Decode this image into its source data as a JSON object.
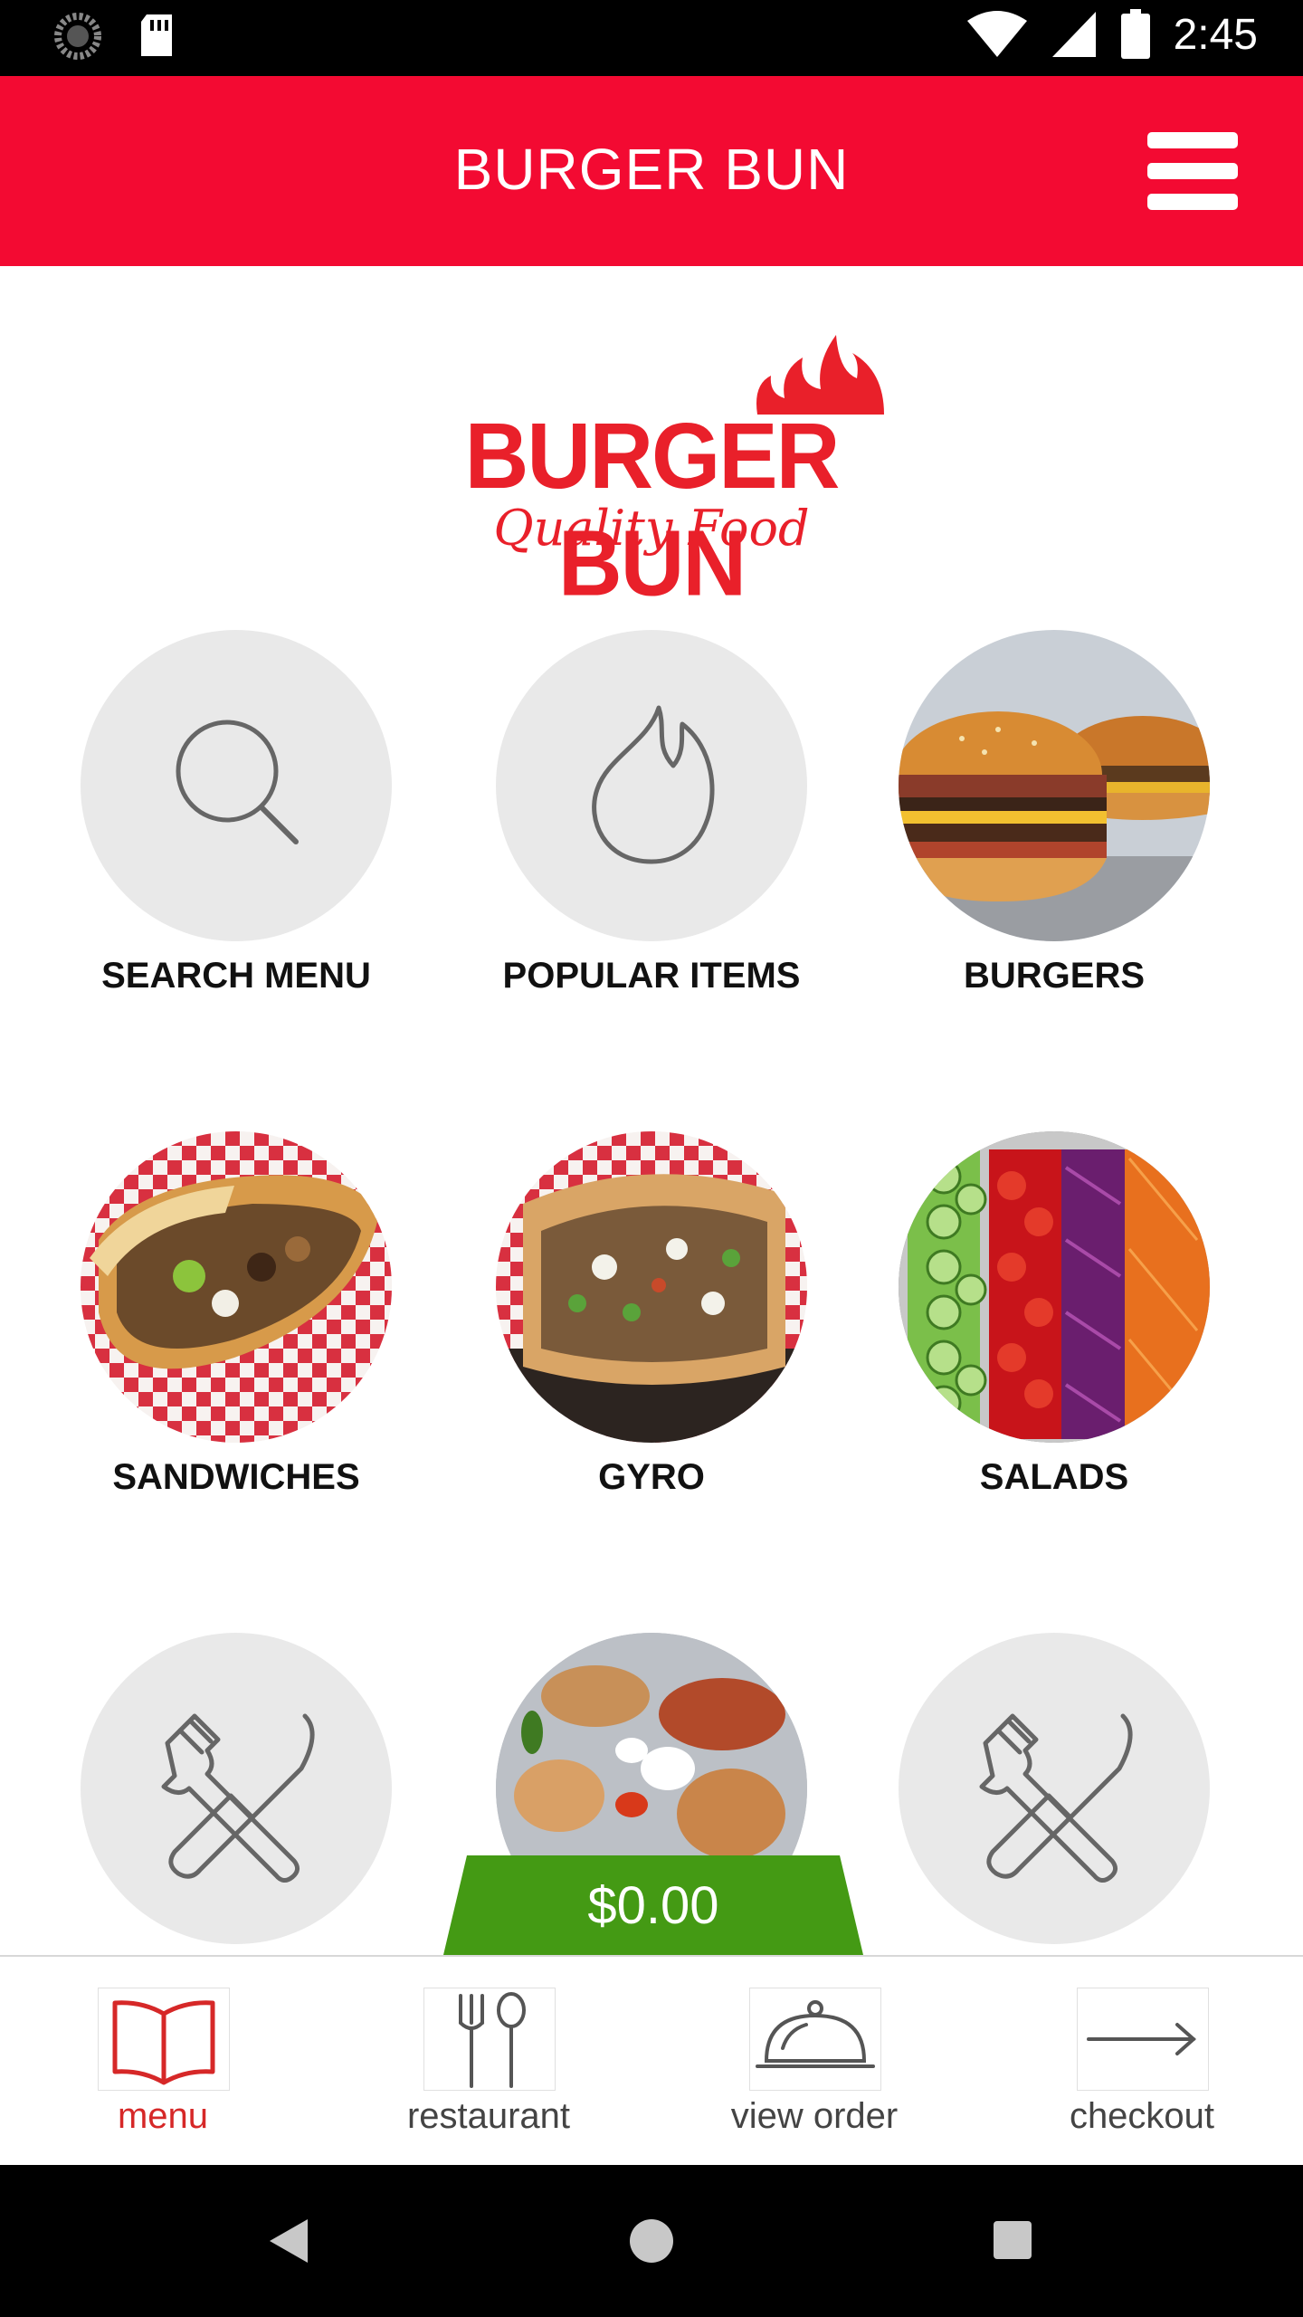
{
  "status_bar": {
    "time": "2:45",
    "icons": [
      "loading-icon",
      "sd-card-icon",
      "wifi-icon",
      "signal-icon",
      "battery-icon"
    ]
  },
  "header": {
    "title": "BURGER BUN",
    "menu_icon": "hamburger-menu-icon",
    "background_color": "#f30a32"
  },
  "logo": {
    "text": "BURGER BUN",
    "tagline": "Quality Food",
    "color": "#e9202a"
  },
  "categories": [
    {
      "label": "SEARCH MENU",
      "icon": "search-icon"
    },
    {
      "label": "POPULAR ITEMS",
      "icon": "flame-icon"
    },
    {
      "label": "BURGERS",
      "image": "burgers-photo"
    },
    {
      "label": "SANDWICHES",
      "image": "sandwich-photo"
    },
    {
      "label": "GYRO",
      "image": "gyro-photo"
    },
    {
      "label": "SALADS",
      "image": "salad-photo"
    },
    {
      "label": "",
      "icon": "utensils-icon"
    },
    {
      "label": "",
      "image": "platter-photo"
    },
    {
      "label": "",
      "icon": "utensils-icon"
    }
  ],
  "order": {
    "total": "$0.00",
    "color": "#449a14"
  },
  "bottom_nav": [
    {
      "label": "menu",
      "icon": "book-icon",
      "active": true
    },
    {
      "label": "restaurant",
      "icon": "fork-spoon-icon",
      "active": false
    },
    {
      "label": "view order",
      "icon": "cloche-icon",
      "active": false
    },
    {
      "label": "checkout",
      "icon": "arrow-right-icon",
      "active": false
    }
  ],
  "system_nav": [
    "back-icon",
    "home-icon",
    "recents-icon"
  ]
}
